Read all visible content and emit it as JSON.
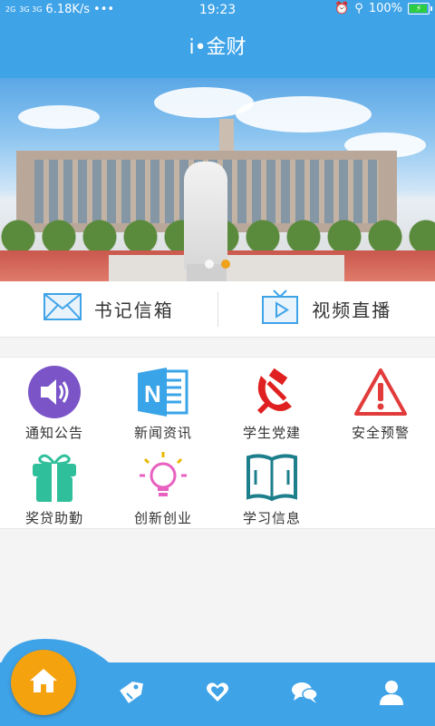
{
  "status_bar": {
    "signal_left": "2G",
    "signal_mid": "3G 3G",
    "net_speed": "6.18K/s",
    "more": "•••",
    "time": "19:23",
    "battery": "100%"
  },
  "header": {
    "title": "i•金财"
  },
  "banner": {
    "slide_count": 2,
    "active_slide": 2
  },
  "quick_links": [
    {
      "label": "书记信箱",
      "icon": "envelope-icon"
    },
    {
      "label": "视频直播",
      "icon": "tv-play-icon"
    }
  ],
  "grid": [
    {
      "label": "通知公告",
      "icon": "speaker-icon",
      "color": "#7b55c8"
    },
    {
      "label": "新闻资讯",
      "icon": "onenote-icon",
      "color": "#3aa4e8"
    },
    {
      "label": "学生党建",
      "icon": "party-emblem-icon",
      "color": "#e02020"
    },
    {
      "label": "安全预警",
      "icon": "warning-icon",
      "color": "#e23b3b"
    },
    {
      "label": "奖贷助勤",
      "icon": "gift-icon",
      "color": "#2fbf9a"
    },
    {
      "label": "创新创业",
      "icon": "lightbulb-icon",
      "color": "#e860c0"
    },
    {
      "label": "学习信息",
      "icon": "book-icon",
      "color": "#1e7f8c"
    }
  ],
  "tabbar": [
    {
      "name": "home",
      "icon": "home-icon"
    },
    {
      "name": "tag",
      "icon": "tag-icon"
    },
    {
      "name": "favorites",
      "icon": "heart-icon"
    },
    {
      "name": "messages",
      "icon": "chat-icon"
    },
    {
      "name": "profile",
      "icon": "user-icon"
    }
  ],
  "colors": {
    "primary": "#3fa3e8",
    "home_button": "#f5a20f"
  }
}
